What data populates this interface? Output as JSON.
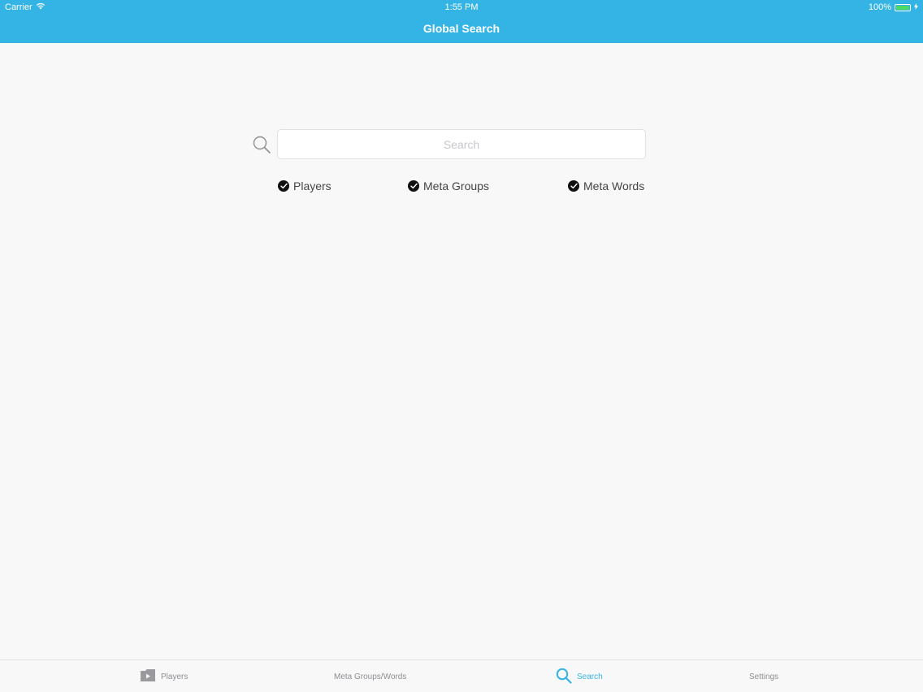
{
  "status_bar": {
    "carrier": "Carrier",
    "time": "1:55 PM",
    "battery": "100%",
    "battery_level": 1.0,
    "battery_color": "#4cd964"
  },
  "nav": {
    "title": "Global Search",
    "bar_color": "#34b4e4"
  },
  "search": {
    "placeholder": "Search",
    "value": "",
    "icon": "magnifier-icon"
  },
  "filters": [
    {
      "label": "Players",
      "checked": true
    },
    {
      "label": "Meta Groups",
      "checked": true
    },
    {
      "label": "Meta Words",
      "checked": true
    }
  ],
  "tabs": [
    {
      "label": "Players",
      "icon": "players-folder-icon",
      "active": false
    },
    {
      "label": "Meta Groups/Words",
      "icon": "",
      "active": false
    },
    {
      "label": "Search",
      "icon": "search-icon",
      "active": true
    },
    {
      "label": "Settings",
      "icon": "",
      "active": false
    }
  ],
  "colors": {
    "accent": "#34b4e4",
    "tab_inactive": "#8e8e93",
    "background": "#f8f8f9"
  }
}
